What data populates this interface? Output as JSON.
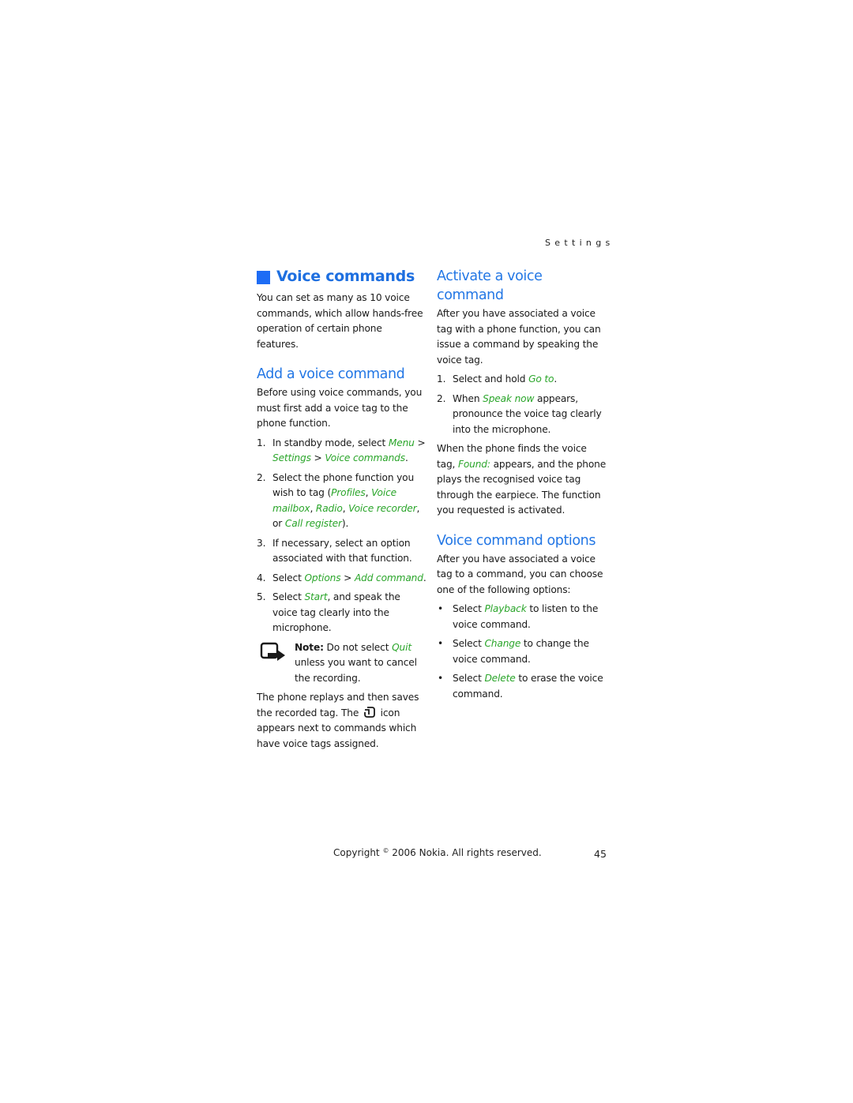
{
  "running_head": "Settings",
  "left_column": {
    "title": "Voice commands",
    "intro": "You can set as many as 10 voice commands, which allow hands-free operation of certain phone features.",
    "add_section": {
      "heading": "Add a voice command",
      "intro": "Before using voice commands, you must first add a voice tag to the phone function.",
      "steps": [
        {
          "num": "1.",
          "parts": [
            {
              "t": "In standby mode, select "
            },
            {
              "t": "Menu",
              "g": true
            },
            {
              "t": " > "
            },
            {
              "t": "Settings",
              "g": true
            },
            {
              "t": " > "
            },
            {
              "t": "Voice commands",
              "g": true
            },
            {
              "t": "."
            }
          ]
        },
        {
          "num": "2.",
          "parts": [
            {
              "t": "Select the phone function you wish to tag ("
            },
            {
              "t": "Profiles",
              "g": true
            },
            {
              "t": ", "
            },
            {
              "t": "Voice mailbox",
              "g": true
            },
            {
              "t": ", "
            },
            {
              "t": "Radio",
              "g": true
            },
            {
              "t": ", "
            },
            {
              "t": "Voice recorder",
              "g": true
            },
            {
              "t": ", or "
            },
            {
              "t": "Call register",
              "g": true
            },
            {
              "t": ")."
            }
          ]
        },
        {
          "num": "3.",
          "parts": [
            {
              "t": "If necessary, select an option associated with that function."
            }
          ]
        },
        {
          "num": "4.",
          "parts": [
            {
              "t": "Select "
            },
            {
              "t": "Options",
              "g": true
            },
            {
              "t": " > "
            },
            {
              "t": "Add command",
              "g": true
            },
            {
              "t": "."
            }
          ]
        },
        {
          "num": "5.",
          "parts": [
            {
              "t": "Select "
            },
            {
              "t": "Start",
              "g": true
            },
            {
              "t": ", and speak the voice tag clearly into the microphone."
            }
          ]
        }
      ],
      "note": {
        "label": "Note:",
        "text_before": " Do not select ",
        "highlight": "Quit",
        "text_after": " unless you want to cancel the recording."
      },
      "closing_before_icon": "The phone replays and then saves the recorded tag. The ",
      "closing_icon": "voice-tag-icon",
      "closing_after_icon": " icon appears next to commands which have voice tags assigned."
    }
  },
  "right_column": {
    "activate_section": {
      "heading": "Activate a voice command",
      "intro": "After you have associated a voice tag with a phone function, you can issue a command by speaking the voice tag.",
      "steps": [
        {
          "num": "1.",
          "parts": [
            {
              "t": "Select and hold "
            },
            {
              "t": "Go to",
              "g": true
            },
            {
              "t": "."
            }
          ]
        },
        {
          "num": "2.",
          "parts": [
            {
              "t": "When "
            },
            {
              "t": "Speak now",
              "g": true
            },
            {
              "t": " appears, pronounce the voice tag clearly into the microphone."
            }
          ]
        }
      ],
      "result_parts": [
        {
          "t": "When the phone finds the voice tag, "
        },
        {
          "t": "Found:",
          "g": true
        },
        {
          "t": " appears, and the phone plays the recognised voice tag through the earpiece. The function you requested is activated."
        }
      ]
    },
    "options_section": {
      "heading": "Voice command options",
      "intro": "After you have associated a voice tag to a command, you can choose one of the following options:",
      "bullets": [
        {
          "parts": [
            {
              "t": "Select "
            },
            {
              "t": "Playback",
              "g": true
            },
            {
              "t": " to listen to the voice command."
            }
          ]
        },
        {
          "parts": [
            {
              "t": "Select "
            },
            {
              "t": "Change",
              "g": true
            },
            {
              "t": " to change the voice command."
            }
          ]
        },
        {
          "parts": [
            {
              "t": "Select "
            },
            {
              "t": "Delete",
              "g": true
            },
            {
              "t": " to erase the voice command."
            }
          ]
        }
      ]
    }
  },
  "footer": {
    "copyright_prefix": "Copyright ",
    "copyright_symbol": "©",
    "copyright_suffix": " 2006 Nokia. All rights reserved.",
    "page_number": "45"
  },
  "colors": {
    "heading_blue": "#2377e5",
    "title_square": "#1d6cf5",
    "ui_term_green": "#2aa52a"
  }
}
